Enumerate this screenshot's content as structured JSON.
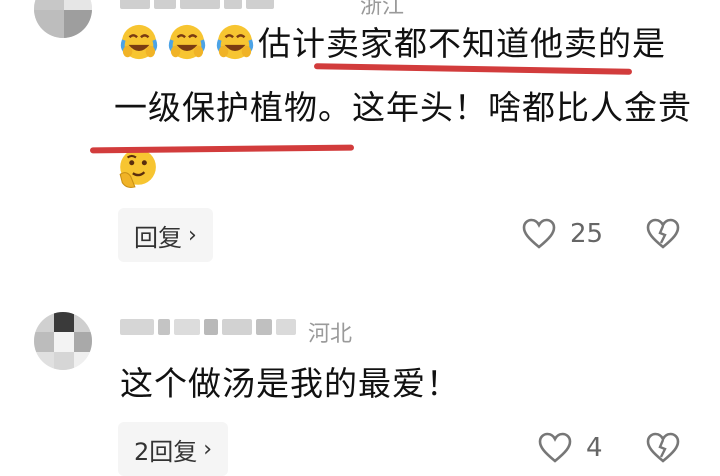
{
  "comments": [
    {
      "location": "浙江",
      "line1": "估计卖家都不知道他卖的是",
      "line2": "一级保护植物。这年头！啥都比人金贵",
      "reply_label": "回复",
      "like_count": "25",
      "emoji_leading": [
        "laughing-crying-emoji",
        "laughing-crying-emoji",
        "laughing-crying-emoji"
      ],
      "emoji_trailing": "thinking-face-emoji"
    },
    {
      "location": "河北",
      "line1": "这个做汤是我的最爱！",
      "reply_label": "2回复",
      "like_count": "4"
    }
  ],
  "colors": {
    "underline": "#d23c3c",
    "reply_bg": "#f5f5f5",
    "muted": "#9a9a9a"
  }
}
